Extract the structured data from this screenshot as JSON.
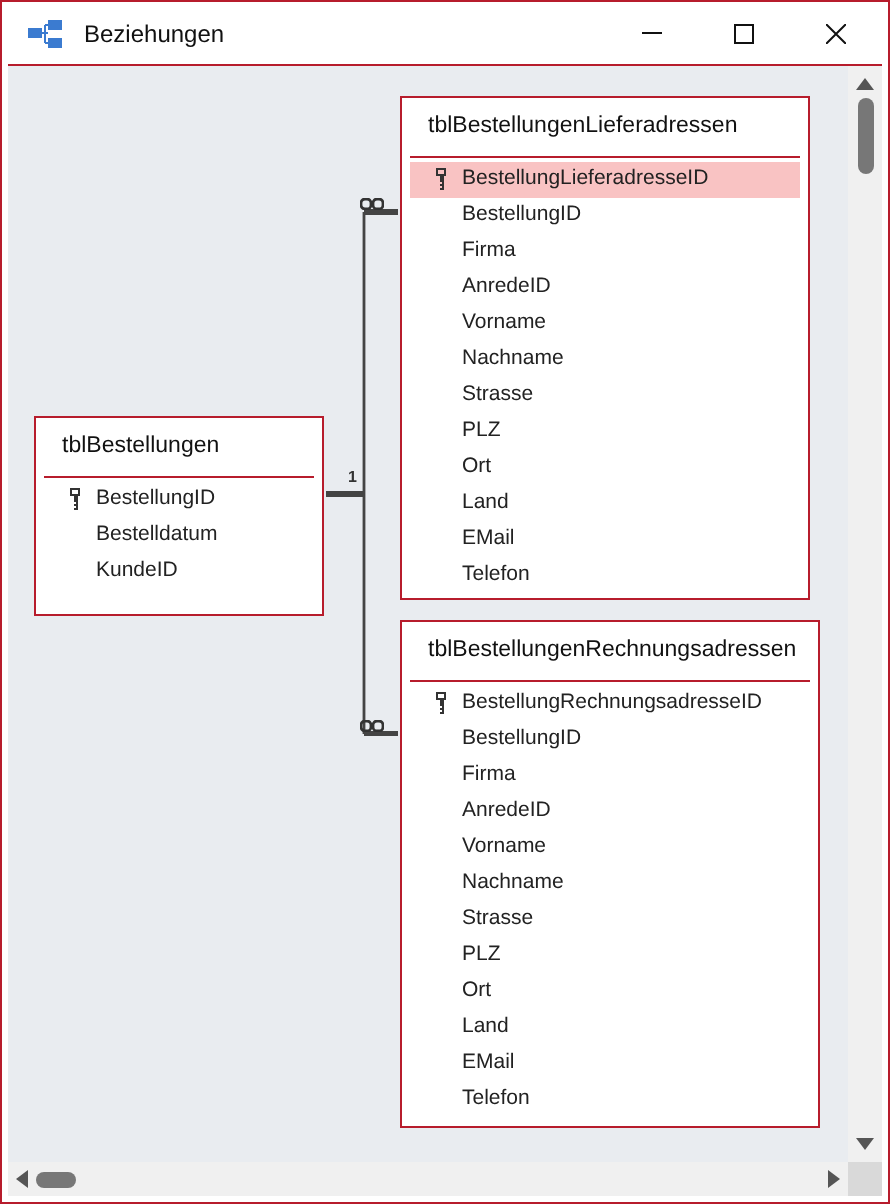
{
  "window": {
    "title": "Beziehungen"
  },
  "tables": [
    {
      "name": "tblBestellungen",
      "fields": [
        {
          "name": "BestellungID",
          "key": true,
          "selected": false
        },
        {
          "name": "Bestelldatum",
          "key": false,
          "selected": false
        },
        {
          "name": "KundeID",
          "key": false,
          "selected": false
        }
      ]
    },
    {
      "name": "tblBestellungenLieferadressen",
      "fields": [
        {
          "name": "BestellungLieferadresseID",
          "key": true,
          "selected": true
        },
        {
          "name": "BestellungID",
          "key": false,
          "selected": false
        },
        {
          "name": "Firma",
          "key": false,
          "selected": false
        },
        {
          "name": "AnredeID",
          "key": false,
          "selected": false
        },
        {
          "name": "Vorname",
          "key": false,
          "selected": false
        },
        {
          "name": "Nachname",
          "key": false,
          "selected": false
        },
        {
          "name": "Strasse",
          "key": false,
          "selected": false
        },
        {
          "name": "PLZ",
          "key": false,
          "selected": false
        },
        {
          "name": "Ort",
          "key": false,
          "selected": false
        },
        {
          "name": "Land",
          "key": false,
          "selected": false
        },
        {
          "name": "EMail",
          "key": false,
          "selected": false
        },
        {
          "name": "Telefon",
          "key": false,
          "selected": false
        }
      ]
    },
    {
      "name": "tblBestellungenRechnungsadressen",
      "fields": [
        {
          "name": "BestellungRechnungsadresseID",
          "key": true,
          "selected": false
        },
        {
          "name": "BestellungID",
          "key": false,
          "selected": false
        },
        {
          "name": "Firma",
          "key": false,
          "selected": false
        },
        {
          "name": "AnredeID",
          "key": false,
          "selected": false
        },
        {
          "name": "Vorname",
          "key": false,
          "selected": false
        },
        {
          "name": "Nachname",
          "key": false,
          "selected": false
        },
        {
          "name": "Strasse",
          "key": false,
          "selected": false
        },
        {
          "name": "PLZ",
          "key": false,
          "selected": false
        },
        {
          "name": "Ort",
          "key": false,
          "selected": false
        },
        {
          "name": "Land",
          "key": false,
          "selected": false
        },
        {
          "name": "EMail",
          "key": false,
          "selected": false
        },
        {
          "name": "Telefon",
          "key": false,
          "selected": false
        }
      ]
    }
  ],
  "relationship": {
    "one_label": "1"
  }
}
